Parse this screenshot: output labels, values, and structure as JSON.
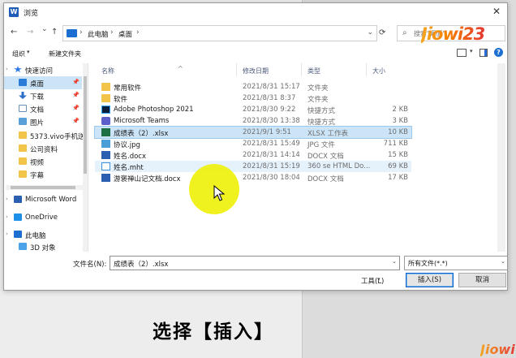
{
  "dialog": {
    "title": "浏览",
    "app_icon_letter": "W",
    "close_glyph": "✕"
  },
  "nav": {
    "back": "←",
    "forward": "→",
    "dropdown": "⌄",
    "up": "↑",
    "breadcrumb": [
      "此电脑",
      "桌面"
    ],
    "separator": "›",
    "refresh": "⟳",
    "search_placeholder": "搜索\"桌面\""
  },
  "watermark": {
    "top": "Jiowi23",
    "bottom": "Jiowi"
  },
  "toolbar": {
    "organize": "组织",
    "new_folder": "新建文件夹",
    "help": "?"
  },
  "sidebar": {
    "items": [
      {
        "label": "快速访问",
        "icon": "star-icon"
      },
      {
        "label": "桌面",
        "icon": "desktop-icon",
        "pinned": true,
        "selected": true
      },
      {
        "label": "下载",
        "icon": "download-icon",
        "pinned": true
      },
      {
        "label": "文档",
        "icon": "document-icon",
        "pinned": true
      },
      {
        "label": "图片",
        "icon": "pictures-icon",
        "pinned": true
      },
      {
        "label": "5373.vivo手机送",
        "icon": "folder-icon"
      },
      {
        "label": "公司资料",
        "icon": "folder-icon"
      },
      {
        "label": "视频",
        "icon": "folder-icon"
      },
      {
        "label": "字幕",
        "icon": "folder-icon"
      },
      {
        "label": "Microsoft Word",
        "icon": "word-icon"
      },
      {
        "label": "OneDrive",
        "icon": "cloud-icon"
      },
      {
        "label": "此电脑",
        "icon": "computer-icon"
      },
      {
        "label": "3D 对象",
        "icon": "3d-objects-icon"
      }
    ],
    "pin_glyph": "📌",
    "expand_glyph": "›"
  },
  "filelist": {
    "columns": [
      "名称",
      "修改日期",
      "类型",
      "大小"
    ],
    "sort_glyph": "^",
    "rows": [
      {
        "name": "常用软件",
        "date": "2021/8/31 15:17",
        "type": "文件夹",
        "size": "",
        "icon": "folder-icon"
      },
      {
        "name": "软件",
        "date": "2021/8/31 8:37",
        "type": "文件夹",
        "size": "",
        "icon": "folder-icon"
      },
      {
        "name": "Adobe Photoshop 2021",
        "date": "2021/8/30 9:22",
        "type": "快捷方式",
        "size": "2 KB",
        "icon": "photoshop-icon"
      },
      {
        "name": "Microsoft Teams",
        "date": "2021/8/30 13:38",
        "type": "快捷方式",
        "size": "3 KB",
        "icon": "teams-icon"
      },
      {
        "name": "成绩表（2）.xlsx",
        "date": "2021/9/1 9:51",
        "type": "XLSX 工作表",
        "size": "10 KB",
        "icon": "excel-icon",
        "selected": true
      },
      {
        "name": "协议.jpg",
        "date": "2021/8/31 15:49",
        "type": "JPG 文件",
        "size": "711 KB",
        "icon": "image-icon"
      },
      {
        "name": "姓名.docx",
        "date": "2021/8/31 14:14",
        "type": "DOCX 文档",
        "size": "15 KB",
        "icon": "word-doc-icon"
      },
      {
        "name": "姓名.mht",
        "date": "2021/8/31 15:19",
        "type": "360 se HTML Do...",
        "size": "69 KB",
        "icon": "mht-icon",
        "hover": true
      },
      {
        "name": "游褒禅山记文档.docx",
        "date": "2021/8/30 18:04",
        "type": "DOCX 文档",
        "size": "17 KB",
        "icon": "word-doc-icon"
      }
    ]
  },
  "footer": {
    "filename_label": "文件名(N):",
    "filename_value": "成绩表（2）.xlsx",
    "filetype_value": "所有文件(*.*)",
    "tools_label": "工具(L)",
    "insert_label": "插入(S)",
    "cancel_label": "取消",
    "dropdown_glyph": "⌄"
  },
  "caption": "选择【插入】",
  "colors": {
    "selection": "#cce4f7",
    "highlight": "#eef000",
    "accent": "#0a64c8"
  }
}
